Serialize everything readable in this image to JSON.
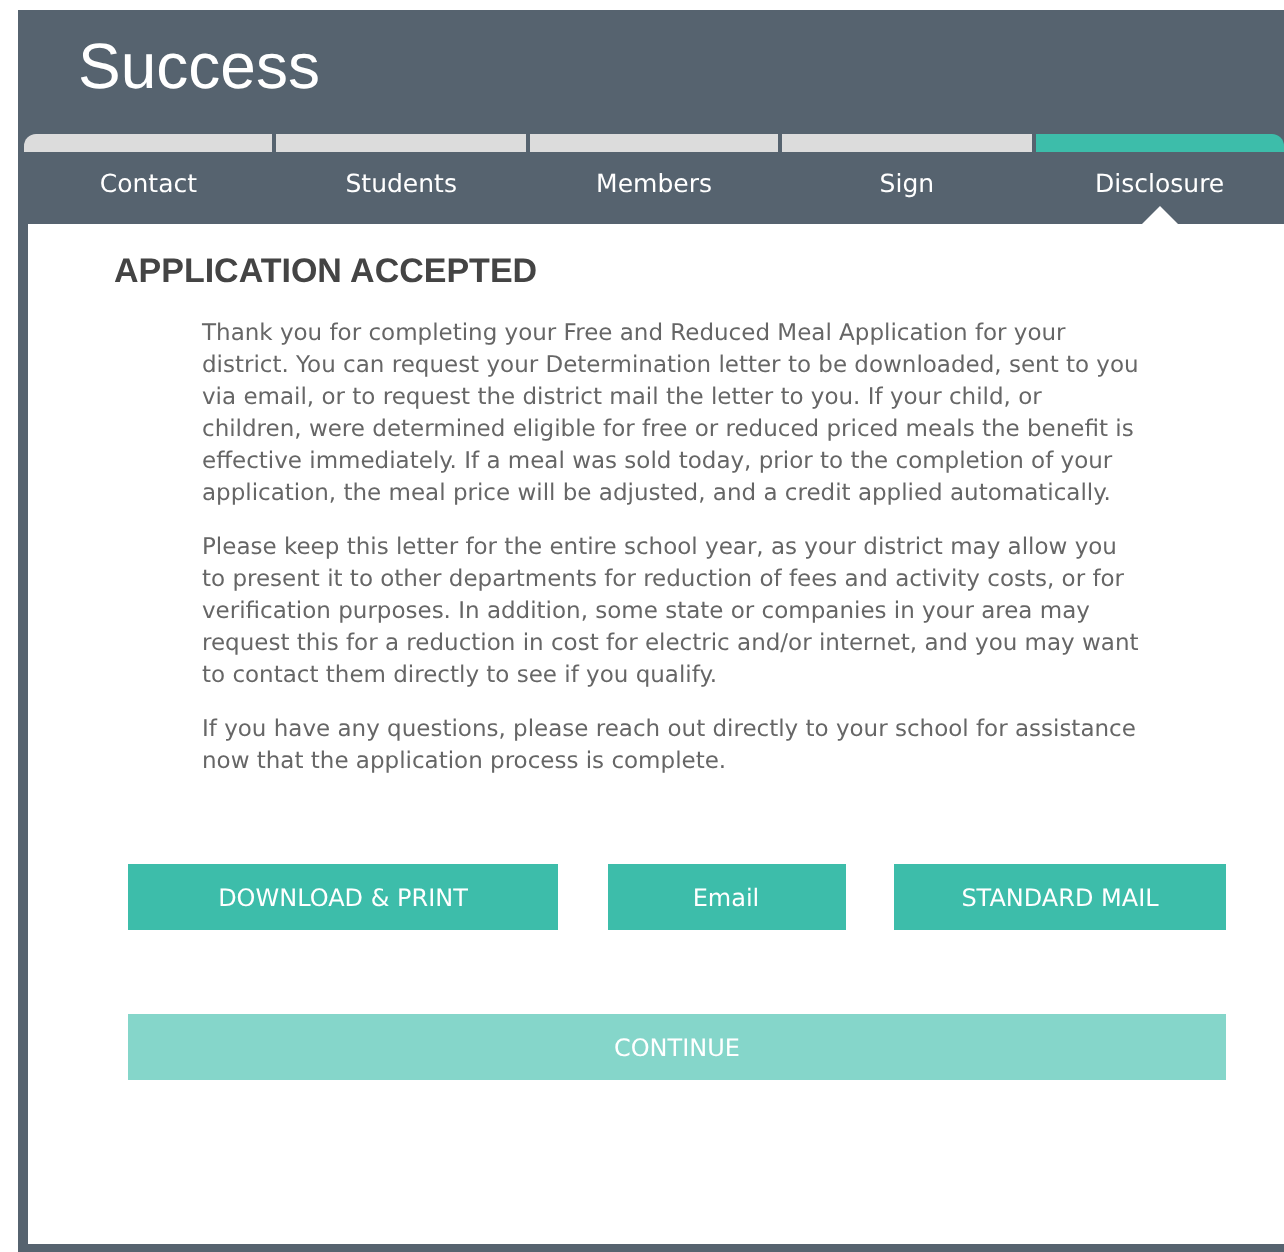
{
  "page_title": "Success",
  "steps": [
    {
      "label": "Contact",
      "selected": false
    },
    {
      "label": "Students",
      "selected": false
    },
    {
      "label": "Members",
      "selected": false
    },
    {
      "label": "Sign",
      "selected": false
    },
    {
      "label": "Disclosure",
      "selected": true
    }
  ],
  "heading": "APPLICATION ACCEPTED",
  "paragraphs": [
    "Thank you for completing your Free and Reduced Meal Application for your district. You can request your Determination letter to be downloaded, sent to you via email, or to request the district mail the letter to you. If your child, or children, were determined eligible for free or reduced priced meals the benefit is effective immediately. If a meal was sold today, prior to the completion of your application, the meal price will be adjusted, and a credit applied automatically.",
    "Please keep this letter for the entire school year, as your district may allow you to present it to other departments for reduction of fees and activity costs, or for verification purposes. In addition, some state or companies in your area may request this for a reduction in cost for electric and/or internet, and you may want to contact them directly to see if you qualify.",
    "If you have any questions, please reach out directly to your school for assistance now that the application process is complete."
  ],
  "actions": [
    {
      "label": "DOWNLOAD & PRINT",
      "kind": "wide"
    },
    {
      "label": "Email",
      "kind": "narrow"
    },
    {
      "label": "STANDARD MAIL",
      "kind": "mid"
    }
  ],
  "continue_button": {
    "label": "CONTINUE",
    "disabled": true
  }
}
